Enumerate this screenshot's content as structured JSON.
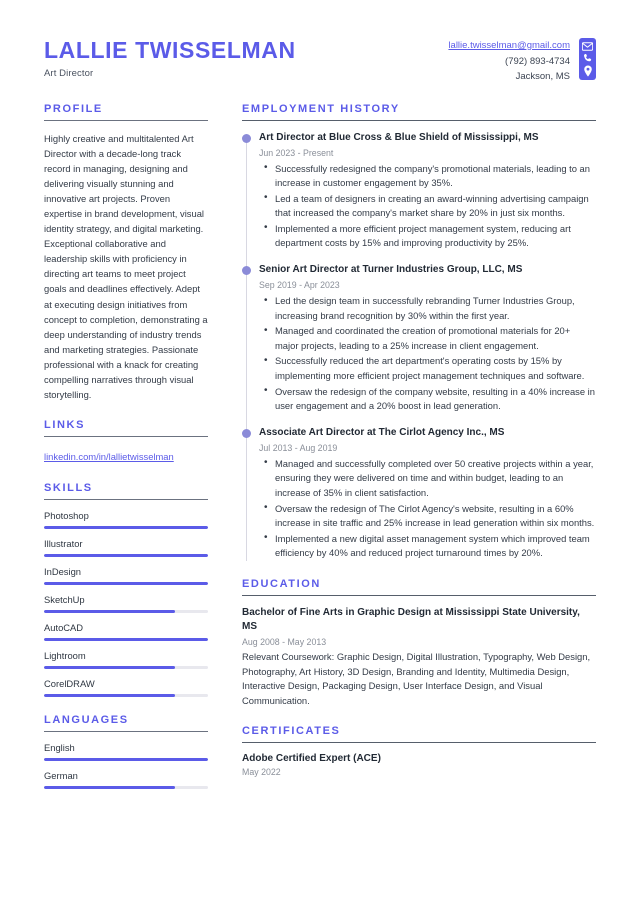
{
  "header": {
    "name": "LALLIE TWISSELMAN",
    "job_title": "Art Director",
    "contact": {
      "email": "lallie.twisselman@gmail.com",
      "phone": "(792) 893-4734",
      "location": "Jackson, MS"
    },
    "icons": [
      "envelope-icon",
      "phone-icon",
      "location-pin-icon"
    ],
    "accent_color": "#5b5be8"
  },
  "left": {
    "profile": {
      "heading": "PROFILE",
      "text": "Highly creative and multitalented Art Director with a decade-long track record in managing, designing and delivering visually stunning and innovative art projects. Proven expertise in brand development, visual identity strategy, and digital marketing. Exceptional collaborative and leadership skills with proficiency in directing art teams to meet project goals and deadlines effectively. Adept at executing design initiatives from concept to completion, demonstrating a deep understanding of industry trends and marketing strategies. Passionate professional with a knack for creating compelling narratives through visual storytelling."
    },
    "links": {
      "heading": "LINKS",
      "items": [
        {
          "label": "linkedin.com/in/lallietwisselman"
        }
      ]
    },
    "skills": {
      "heading": "SKILLS",
      "items": [
        {
          "name": "Photoshop",
          "level": 100
        },
        {
          "name": "Illustrator",
          "level": 100
        },
        {
          "name": "InDesign",
          "level": 100
        },
        {
          "name": "SketchUp",
          "level": 80
        },
        {
          "name": "AutoCAD",
          "level": 100
        },
        {
          "name": "Lightroom",
          "level": 80
        },
        {
          "name": "CorelDRAW",
          "level": 80
        }
      ]
    },
    "languages": {
      "heading": "LANGUAGES",
      "items": [
        {
          "name": "English",
          "level": 100
        },
        {
          "name": "German",
          "level": 80
        }
      ]
    }
  },
  "right": {
    "employment": {
      "heading": "EMPLOYMENT HISTORY",
      "jobs": [
        {
          "title": "Art Director at Blue Cross & Blue Shield of Mississippi, MS",
          "dates": "Jun 2023 - Present",
          "bullets": [
            "Successfully redesigned the company's promotional materials, leading to an increase in customer engagement by 35%.",
            "Led a team of designers in creating an award-winning advertising campaign that increased the company's market share by 20% in just six months.",
            "Implemented a more efficient project management system, reducing art department costs by 15% and improving productivity by 25%."
          ]
        },
        {
          "title": "Senior Art Director at Turner Industries Group, LLC, MS",
          "dates": "Sep 2019 - Apr 2023",
          "bullets": [
            "Led the design team in successfully rebranding Turner Industries Group, increasing brand recognition by 30% within the first year.",
            "Managed and coordinated the creation of promotional materials for 20+ major projects, leading to a 25% increase in client engagement.",
            "Successfully reduced the art department's operating costs by 15% by implementing more efficient project management techniques and software.",
            "Oversaw the redesign of the company website, resulting in a 40% increase in user engagement and a 20% boost in lead generation."
          ]
        },
        {
          "title": "Associate Art Director at The Cirlot Agency Inc., MS",
          "dates": "Jul 2013 - Aug 2019",
          "bullets": [
            "Managed and successfully completed over 50 creative projects within a year, ensuring they were delivered on time and within budget, leading to an increase of 35% in client satisfaction.",
            "Oversaw the redesign of The Cirlot Agency's website, resulting in a 60% increase in site traffic and 25% increase in lead generation within six months.",
            "Implemented a new digital asset management system which improved team efficiency by 40% and reduced project turnaround times by 20%."
          ]
        }
      ]
    },
    "education": {
      "heading": "EDUCATION",
      "entries": [
        {
          "degree": "Bachelor of Fine Arts in Graphic Design at Mississippi State University, MS",
          "dates": "Aug 2008 - May 2013",
          "description": "Relevant Coursework: Graphic Design, Digital Illustration, Typography, Web Design, Photography, Art History, 3D Design, Branding and Identity, Multimedia Design, Interactive Design, Packaging Design, User Interface Design, and Visual Communication."
        }
      ]
    },
    "certificates": {
      "heading": "CERTIFICATES",
      "entries": [
        {
          "title": "Adobe Certified Expert (ACE)",
          "date": "May 2022"
        }
      ]
    }
  }
}
